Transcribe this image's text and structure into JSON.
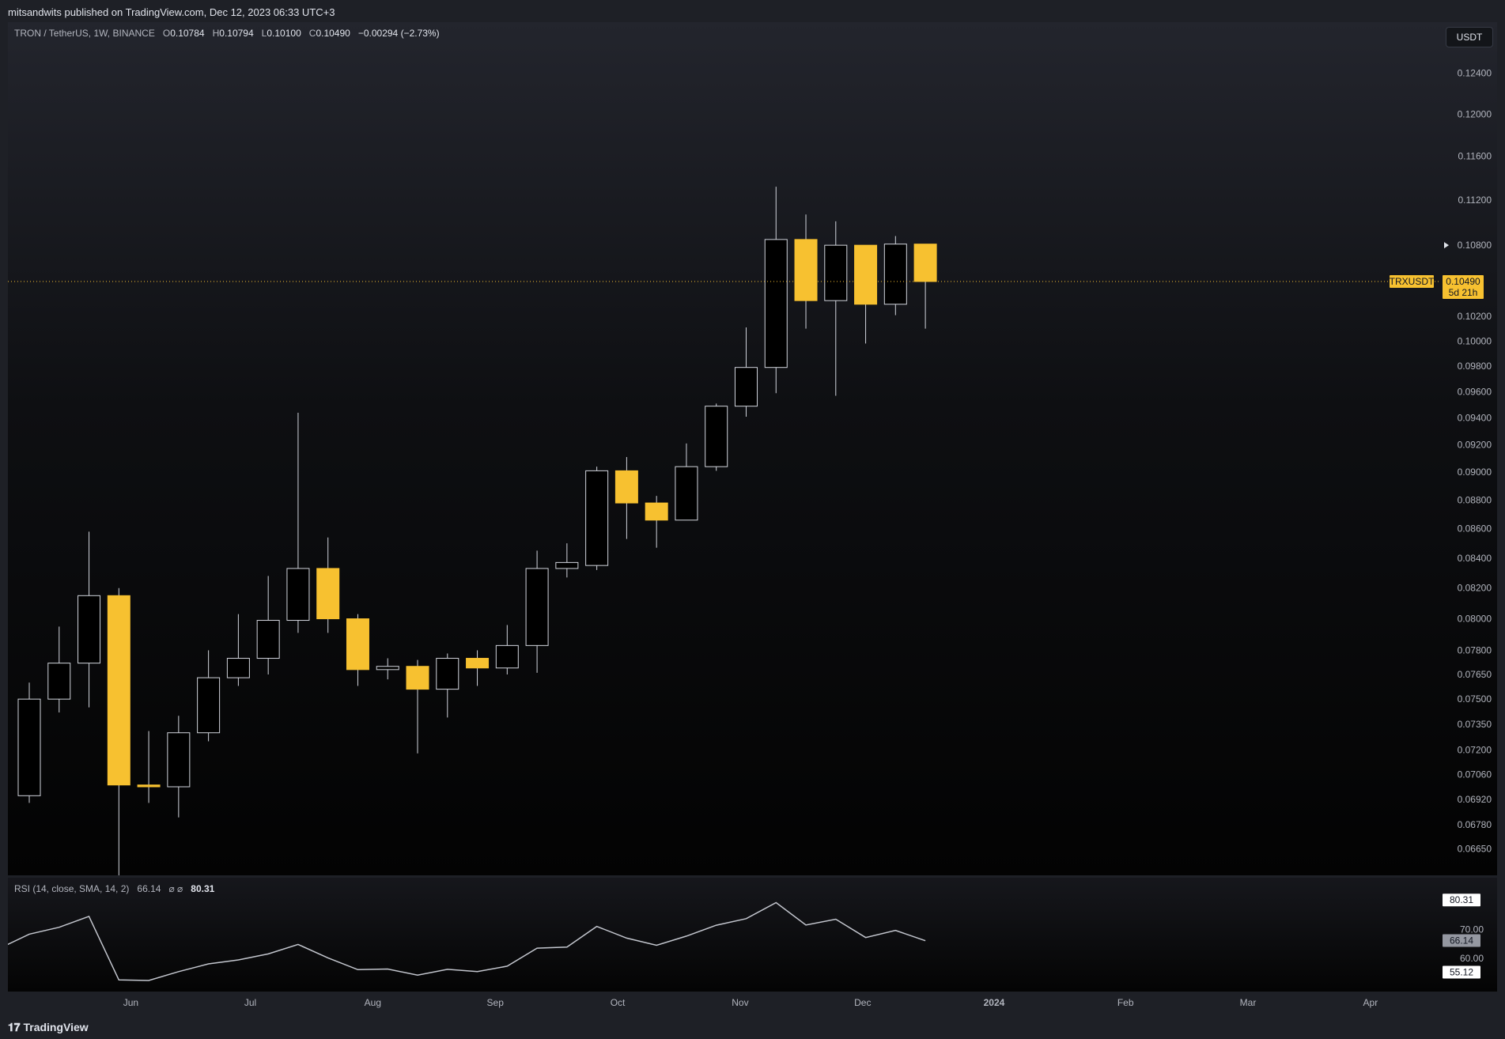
{
  "header": {
    "published": "mitsandwits published on TradingView.com, Dec 12, 2023 06:33 UTC+3"
  },
  "footer": {
    "brand": "TradingView"
  },
  "legend": {
    "symbol": "TRON / TetherUS, 1W, BINANCE",
    "o_label": "O",
    "o": "0.10784",
    "h_label": "H",
    "h": "0.10794",
    "l_label": "L",
    "l": "0.10100",
    "c_label": "C",
    "c": "0.10490",
    "change": "−0.00294 (−2.73%)"
  },
  "currency_button": "USDT",
  "price_label": {
    "ticker": "TRXUSDT",
    "price": "0.10490",
    "countdown": "5d 21h"
  },
  "rsi_legend": {
    "name": "RSI (14, close, SMA, 14, 2)",
    "value": "66.14",
    "symbols": "⌀ ⌀",
    "ma": "80.31"
  },
  "rsi_badges": {
    "top": "80.31",
    "current": "66.14",
    "bottom": "55.12"
  },
  "colors": {
    "up_fill": "#000000",
    "down_fill": "#f7c130",
    "wick": "#d1d4dc",
    "rsi_line": "#c3c6ce",
    "price_line": "#f7c130"
  },
  "chart_data": [
    {
      "type": "candlestick",
      "title": "TRON / TetherUS, 1W, BINANCE",
      "x_ticks": [
        "Jun",
        "Jul",
        "Aug",
        "Sep",
        "Oct",
        "Nov",
        "Dec",
        "2024",
        "Feb",
        "Mar",
        "Apr"
      ],
      "y_ticks": [
        "0.12400",
        "0.12000",
        "0.11600",
        "0.11200",
        "0.10800",
        "0.10200",
        "0.10000",
        "0.09800",
        "0.09600",
        "0.09400",
        "0.09200",
        "0.09000",
        "0.08800",
        "0.08600",
        "0.08400",
        "0.08200",
        "0.08000",
        "0.07800",
        "0.07650",
        "0.07500",
        "0.07350",
        "0.07200",
        "0.07060",
        "0.06920",
        "0.06780",
        "0.06650"
      ],
      "y_scale": "log",
      "ylim": [
        0.0651,
        0.1292
      ],
      "current_price": 0.1049,
      "candles": [
        {
          "o": 0.0694,
          "h": 0.076,
          "l": 0.069,
          "c": 0.075
        },
        {
          "o": 0.075,
          "h": 0.0795,
          "l": 0.0742,
          "c": 0.0772
        },
        {
          "o": 0.0772,
          "h": 0.0858,
          "l": 0.0745,
          "c": 0.0815
        },
        {
          "o": 0.0815,
          "h": 0.082,
          "l": 0.0634,
          "c": 0.07
        },
        {
          "o": 0.07,
          "h": 0.0731,
          "l": 0.069,
          "c": 0.0699
        },
        {
          "o": 0.0699,
          "h": 0.074,
          "l": 0.0682,
          "c": 0.073
        },
        {
          "o": 0.073,
          "h": 0.078,
          "l": 0.0725,
          "c": 0.0763
        },
        {
          "o": 0.0763,
          "h": 0.0803,
          "l": 0.0758,
          "c": 0.0775
        },
        {
          "o": 0.0775,
          "h": 0.0828,
          "l": 0.0765,
          "c": 0.0799
        },
        {
          "o": 0.0799,
          "h": 0.0944,
          "l": 0.0791,
          "c": 0.0833
        },
        {
          "o": 0.0833,
          "h": 0.0854,
          "l": 0.0791,
          "c": 0.08
        },
        {
          "o": 0.08,
          "h": 0.0803,
          "l": 0.0758,
          "c": 0.0768
        },
        {
          "o": 0.0768,
          "h": 0.0775,
          "l": 0.0762,
          "c": 0.077
        },
        {
          "o": 0.077,
          "h": 0.0774,
          "l": 0.0718,
          "c": 0.0756
        },
        {
          "o": 0.0756,
          "h": 0.0778,
          "l": 0.0739,
          "c": 0.0775
        },
        {
          "o": 0.0775,
          "h": 0.078,
          "l": 0.0758,
          "c": 0.0769
        },
        {
          "o": 0.0769,
          "h": 0.0796,
          "l": 0.0765,
          "c": 0.0783
        },
        {
          "o": 0.0783,
          "h": 0.0845,
          "l": 0.0766,
          "c": 0.0833
        },
        {
          "o": 0.0833,
          "h": 0.085,
          "l": 0.0827,
          "c": 0.0837
        },
        {
          "o": 0.0835,
          "h": 0.0904,
          "l": 0.0832,
          "c": 0.0901
        },
        {
          "o": 0.0901,
          "h": 0.0911,
          "l": 0.0853,
          "c": 0.0878
        },
        {
          "o": 0.0878,
          "h": 0.0883,
          "l": 0.0847,
          "c": 0.0866
        },
        {
          "o": 0.0866,
          "h": 0.0921,
          "l": 0.0866,
          "c": 0.0904
        },
        {
          "o": 0.0904,
          "h": 0.0951,
          "l": 0.0901,
          "c": 0.0949
        },
        {
          "o": 0.0949,
          "h": 0.1011,
          "l": 0.0941,
          "c": 0.0979
        },
        {
          "o": 0.0979,
          "h": 0.1132,
          "l": 0.0959,
          "c": 0.1085
        },
        {
          "o": 0.1085,
          "h": 0.1107,
          "l": 0.101,
          "c": 0.1033
        },
        {
          "o": 0.1033,
          "h": 0.1101,
          "l": 0.0957,
          "c": 0.108
        },
        {
          "o": 0.108,
          "h": 0.108,
          "l": 0.0998,
          "c": 0.103
        },
        {
          "o": 0.103,
          "h": 0.1088,
          "l": 0.1021,
          "c": 0.1081
        },
        {
          "o": 0.1081,
          "h": 0.1081,
          "l": 0.101,
          "c": 0.1049
        }
      ]
    },
    {
      "type": "line",
      "title": "RSI (14, close, SMA, 14, 2)",
      "y_ticks": [
        "70.00",
        "60.00"
      ],
      "ylim": [
        50,
        87
      ],
      "values": [
        63.4,
        68.4,
        70.8,
        74.6,
        52.4,
        52.2,
        55.3,
        58.0,
        59.4,
        61.5,
        64.8,
        60.1,
        56.0,
        56.2,
        54.1,
        56.1,
        55.3,
        57.2,
        63.5,
        63.9,
        71.1,
        67.0,
        64.5,
        67.7,
        71.5,
        73.8,
        79.4,
        71.6,
        73.6,
        67.2,
        69.7,
        66.1
      ]
    }
  ]
}
